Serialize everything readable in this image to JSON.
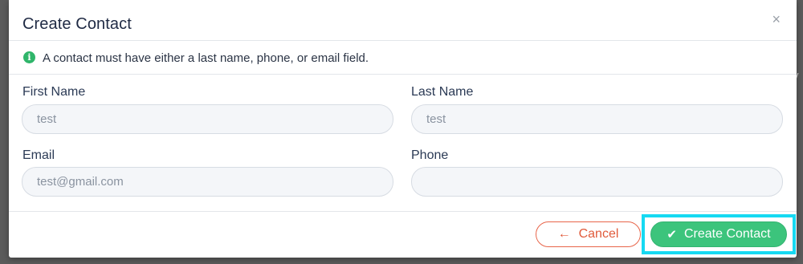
{
  "modal": {
    "title": "Create Contact",
    "close_icon": "×",
    "notice": "A contact must have either a last name, phone, or email field."
  },
  "fields": {
    "first_name": {
      "label": "First Name",
      "value": "test"
    },
    "last_name": {
      "label": "Last Name",
      "value": "test"
    },
    "email": {
      "label": "Email",
      "value": "test@gmail.com"
    },
    "phone": {
      "label": "Phone",
      "value": ""
    }
  },
  "footer": {
    "cancel_label": "Cancel",
    "cancel_icon": "←",
    "create_label": "Create Contact",
    "create_icon": "✔"
  },
  "colors": {
    "accent_green": "#3cc47c",
    "cancel_red": "#e05a3a",
    "highlight": "#16d9f2"
  }
}
